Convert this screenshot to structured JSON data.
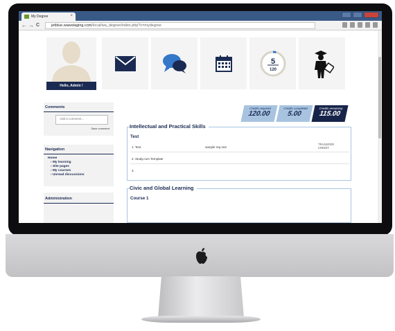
{
  "browser": {
    "tab_title": "My Degree",
    "tab_close": "×",
    "nav_back": "←",
    "nav_forward": "→",
    "nav_reload": "C",
    "url_host": "jetblue.wawstaging.com",
    "url_path": "/local/wa_degree/index.php?c=mydegree"
  },
  "profile": {
    "greeting": "Hello, Admin !"
  },
  "tiles": {
    "messages_icon": "envelope-icon",
    "forum_icon": "chat-bubbles-icon",
    "calendar_icon": "calendar-icon",
    "progress_value": "5",
    "progress_total": "120",
    "graduate_icon": "graduate-icon"
  },
  "comments": {
    "title": "Comments",
    "placeholder": "Add a comment...",
    "save_label": "Save comment"
  },
  "navigation": {
    "title": "Navigation",
    "home": "Home",
    "items": [
      {
        "label": "My learning"
      },
      {
        "label": "Site pages"
      },
      {
        "label": "My courses"
      },
      {
        "label": "Unread discussions"
      }
    ]
  },
  "administration": {
    "title": "Administration"
  },
  "credits": {
    "required_label": "Credits required",
    "required_value": "120.00",
    "completed_label": "Credits completed",
    "completed_value": "5.00",
    "remaining_label": "Credits remaining",
    "remaining_value": "115.00"
  },
  "sections": [
    {
      "title": "Intellectual and Practical Skills",
      "group": "Test",
      "rows": [
        {
          "col1": "1. Test",
          "col2": "sample req mst",
          "col3": "TRANSFER CREDIT"
        },
        {
          "col1": "2. Study.com Template",
          "col2": "",
          "col3": ""
        },
        {
          "col1": "3.",
          "col2": "",
          "col3": ""
        }
      ]
    },
    {
      "title": "Civic and Global Learning",
      "group": "Course 1",
      "rows": []
    }
  ],
  "colors": {
    "navy": "#1a2a52",
    "light_blue": "#a7c3e0",
    "browser_blue": "#3a5a86"
  }
}
